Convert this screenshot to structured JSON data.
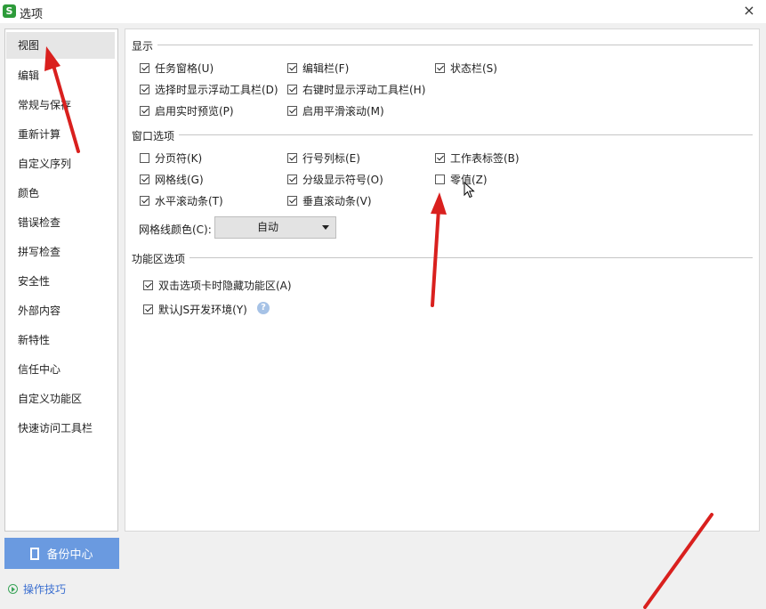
{
  "window": {
    "title": "选项",
    "app_icon": "S",
    "close_label": "×"
  },
  "sidebar": {
    "items": [
      {
        "label": "视图",
        "active": true
      },
      {
        "label": "编辑"
      },
      {
        "label": "常规与保存"
      },
      {
        "label": "重新计算"
      },
      {
        "label": "自定义序列"
      },
      {
        "label": "颜色"
      },
      {
        "label": "错误检查"
      },
      {
        "label": "拼写检查"
      },
      {
        "label": "安全性"
      },
      {
        "label": "外部内容"
      },
      {
        "label": "新特性"
      },
      {
        "label": "信任中心"
      },
      {
        "label": "自定义功能区"
      },
      {
        "label": "快速访问工具栏"
      }
    ],
    "backup_label": "备份中心",
    "tips_label": "操作技巧"
  },
  "display": {
    "title": "显示",
    "options": [
      {
        "label": "任务窗格(U)",
        "checked": true
      },
      {
        "label": "编辑栏(F)",
        "checked": true
      },
      {
        "label": "状态栏(S)",
        "checked": true
      },
      {
        "label": "选择时显示浮动工具栏(D)",
        "checked": true
      },
      {
        "label": "右键时显示浮动工具栏(H)",
        "checked": true
      },
      {
        "label": "启用实时预览(P)",
        "checked": true
      },
      {
        "label": "启用平滑滚动(M)",
        "checked": true
      }
    ]
  },
  "window_options": {
    "title": "窗口选项",
    "options": [
      {
        "label": "分页符(K)",
        "checked": false
      },
      {
        "label": "行号列标(E)",
        "checked": true
      },
      {
        "label": "工作表标签(B)",
        "checked": true
      },
      {
        "label": "网格线(G)",
        "checked": true
      },
      {
        "label": "分级显示符号(O)",
        "checked": true
      },
      {
        "label": "零值(Z)",
        "checked": false
      },
      {
        "label": "水平滚动条(T)",
        "checked": true
      },
      {
        "label": "垂直滚动条(V)",
        "checked": true
      }
    ],
    "grid_color_label": "网格线颜色(C):",
    "grid_color_value": "自动"
  },
  "ribbon": {
    "title": "功能区选项",
    "options": [
      {
        "label": "双击选项卡时隐藏功能区(A)",
        "checked": true
      },
      {
        "label": "默认JS开发环境(Y)",
        "checked": true
      }
    ],
    "help_icon": "?"
  },
  "colors": {
    "accent": "#6a9ae0",
    "arrow": "#d9201e",
    "link": "#3b6fd0"
  }
}
